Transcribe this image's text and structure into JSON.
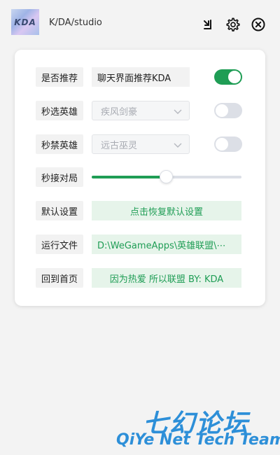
{
  "header": {
    "logo_text": "KDA",
    "app_name": "K/DA/studio",
    "icons": {
      "minimize": "minimize-icon",
      "settings": "gear-icon",
      "close": "close-icon"
    }
  },
  "settings": {
    "recommend": {
      "label": "是否推荐",
      "value": "聊天界面推荐KDA",
      "enabled": true
    },
    "pick_hero": {
      "label": "秒选英雄",
      "placeholder": "疾风剑豪",
      "enabled": false
    },
    "ban_hero": {
      "label": "秒禁英雄",
      "placeholder": "远古巫灵",
      "enabled": false
    },
    "accept_match": {
      "label": "秒接对局",
      "level_percent": 50
    },
    "defaults": {
      "label": "默认设置",
      "button": "点击恢复默认设置"
    },
    "run_file": {
      "label": "运行文件",
      "path": "D:\\WeGameApps\\英雄联盟\\⋯"
    },
    "home": {
      "label": "回到首页",
      "button": "因为热爱 所以联盟 BY: KDA"
    }
  },
  "watermark": {
    "cn": "七幻论坛",
    "en": "QiYe Net Tech Team"
  },
  "colors": {
    "accent": "#1f9d55",
    "accent_bg": "#e6f4ea",
    "toggle_off": "#dcdfe6",
    "watermark": "#2d8fd8"
  }
}
